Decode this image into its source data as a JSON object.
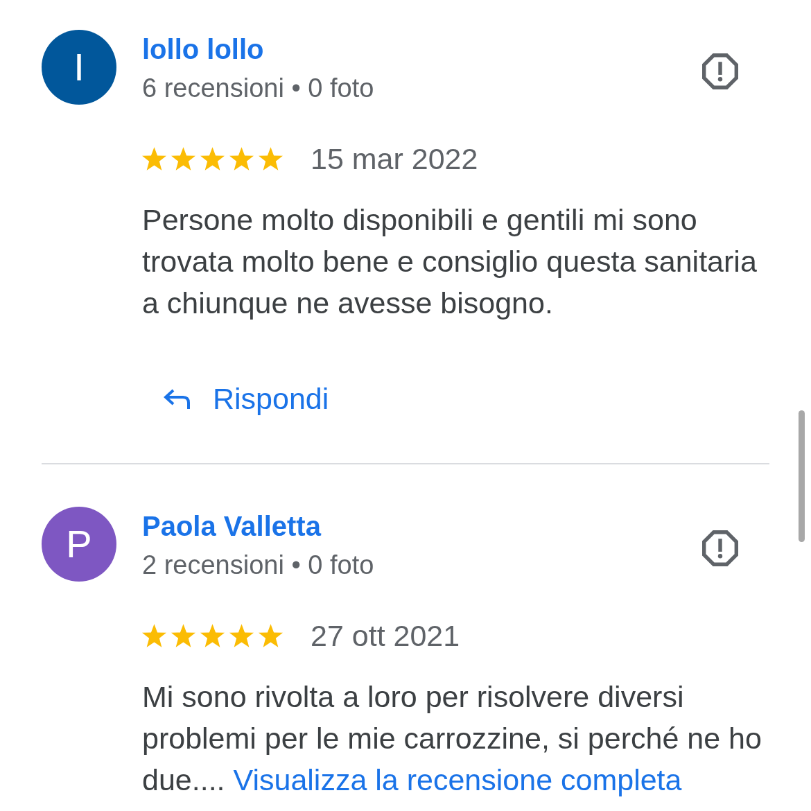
{
  "reviews": [
    {
      "author": "lollo lollo",
      "avatar": {
        "letter": "I",
        "color": "#01579b"
      },
      "meta": "6 recensioni • 0 foto",
      "stars": 5,
      "date": "15 mar 2022",
      "text": "Persone molto disponibili e gentili mi sono trovata molto bene e consiglio questa sanitaria a chiunque ne avesse bisogno.",
      "reply_button": "Rispondi"
    },
    {
      "author": "Paola Valletta",
      "avatar": {
        "letter": "P",
        "color": "#7e57c2"
      },
      "meta": "2 recensioni • 0 foto",
      "stars": 5,
      "date": "27 ott 2021",
      "text": "Mi sono rivolta a loro per risolvere diversi problemi per le mie carrozzine, si perché ne ho due....",
      "more_link": "Visualizza la recensione completa"
    }
  ]
}
